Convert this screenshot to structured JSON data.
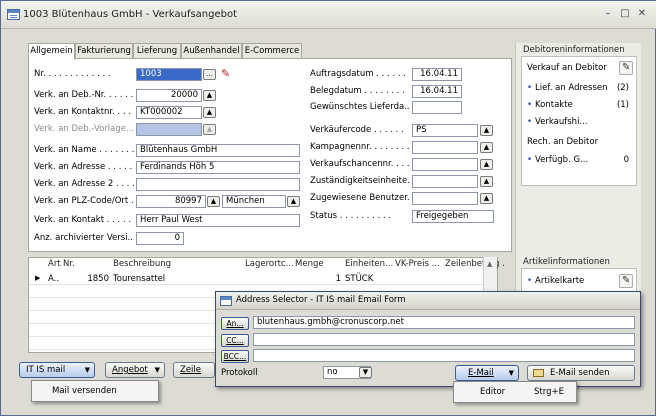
{
  "window": {
    "title": "1003 Blütenhaus GmbH - Verkaufsangebot"
  },
  "tabs": [
    "Allgemein",
    "Fakturierung",
    "Lieferung",
    "Außenhandel",
    "E-Commerce"
  ],
  "general_left": [
    {
      "label": "Nr. . . . . . . . . . . . .",
      "value": "1003"
    },
    {
      "label": "Verk. an Deb.-Nr. . . . . . .",
      "value": "20000"
    },
    {
      "label": "Verk. an Kontaktnr. . . . . .",
      "value": "KT000002"
    },
    {
      "label": "Verk. an Deb.-Vorlage...",
      "value": ""
    },
    {
      "label": "Verk. an Name . . . . . . .",
      "value": "Blütenhaus GmbH"
    },
    {
      "label": "Verk. an Adresse . . . . .",
      "value": "Ferdinands Höh 5"
    },
    {
      "label": "Verk. an Adresse 2 . . . .",
      "value": ""
    },
    {
      "label": "Verk. an PLZ-Code/Ort . .",
      "value": "80997",
      "city": "München"
    },
    {
      "label": "Verk. an Kontakt . . . . .",
      "value": "Herr Paul West"
    },
    {
      "label": "Anz. archivierter Versi...",
      "value": "0"
    }
  ],
  "general_right": [
    {
      "label": "Auftragsdatum . . . . . .",
      "value": "16.04.11"
    },
    {
      "label": "Belegdatum . . . . . . . .",
      "value": "16.04.11"
    },
    {
      "label": "Gewünschtes Lieferda...",
      "value": ""
    },
    {
      "label": "Verkäufercode . . . . . .",
      "value": "PS"
    },
    {
      "label": "Kampagnennr. . . . . . . .",
      "value": ""
    },
    {
      "label": "Verkaufschancennr. . . .",
      "value": ""
    },
    {
      "label": "Zuständigkeitseinheite...",
      "value": ""
    },
    {
      "label": "Zugewiesene Benutzer...",
      "value": ""
    },
    {
      "label": "Status . . . . . . . . . .",
      "value": "Freigegeben"
    }
  ],
  "factbox": {
    "debitor_title": "Debitoreninformationen",
    "verkauf_label": "Verkauf an Debitor",
    "links": [
      {
        "label": "Lief. an Adressen",
        "count": "(2)"
      },
      {
        "label": "Kontakte",
        "count": "(1)"
      },
      {
        "label": "Verkaufshi...",
        "count": ""
      }
    ],
    "rech_label": "Rech. an Debitor",
    "verfuegb": {
      "label": "Verfügb. G...",
      "count": "0"
    },
    "artikel_title": "Artikelinformationen",
    "artikelkarte": "Artikelkarte"
  },
  "lines": {
    "headers": [
      "Art",
      "Nr.",
      "Beschreibung",
      "Lagerortc...",
      "Menge",
      "Einheiten...",
      "VK-Preis ...",
      "Zeilenbetrag ."
    ],
    "rows": [
      {
        "art": "A..",
        "nr": "1850",
        "beschreibung": "Tourensattel",
        "menge": "1",
        "einheit": "STÜCK"
      }
    ]
  },
  "bottom": {
    "mail_button": "IT IS mail",
    "angebot_button": "Angebot",
    "zeile_button": "Zeile",
    "mail_menu_item": "Mail versenden"
  },
  "dialog": {
    "title": "Address Selector - IT IS mail Email Form",
    "an_label": "An...",
    "an_value": "blutenhaus.gmbh@cronuscorp.net",
    "cc_label": "CC...",
    "bcc_label": "BCC...",
    "protokoll_label": "Protokoll",
    "protokoll_value": "no",
    "email_button": "E-Mail",
    "send_button": "E-Mail senden",
    "editor_item": "Editor",
    "editor_shortcut": "Strg+E"
  }
}
